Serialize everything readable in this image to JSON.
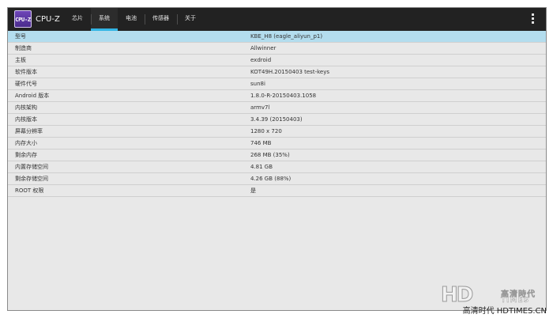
{
  "app": {
    "title": "CPU-Z",
    "icon_label": "CPU-Z",
    "icon": "cpu-z-app-icon"
  },
  "tabs": [
    {
      "label": "芯片",
      "active": false
    },
    {
      "label": "系统",
      "active": true
    },
    {
      "label": "电池",
      "active": false
    },
    {
      "label": "传感器",
      "active": false
    },
    {
      "label": "关于",
      "active": false
    }
  ],
  "menu_icon": "overflow-menu-icon",
  "colors": {
    "actionbar": "#222222",
    "tab_indicator": "#33b5e5",
    "selected_row": "#b3ddee",
    "background": "#e8e8e8"
  },
  "system_info": [
    {
      "label": "型号",
      "value": "KBE_H8 (eagle_aliyun_p1)"
    },
    {
      "label": "制造商",
      "value": "Allwinner"
    },
    {
      "label": "主板",
      "value": "exdroid"
    },
    {
      "label": "软件版本",
      "value": "KOT49H.20150403 test-keys"
    },
    {
      "label": "硬件代号",
      "value": "sun8i"
    },
    {
      "label": "Android 版本",
      "value": "1.8.0-R-20150403.1058"
    },
    {
      "label": "内核架构",
      "value": "armv7l"
    },
    {
      "label": "内核版本",
      "value": "3.4.39 (20150403)"
    },
    {
      "label": "屏幕分辨率",
      "value": "1280 x 720"
    },
    {
      "label": "内存大小",
      "value": "746 MB"
    },
    {
      "label": "剩余内存",
      "value": "268 MB  (35%)"
    },
    {
      "label": "内置存储空间",
      "value": "4.81 GB"
    },
    {
      "label": "剩余存储空间",
      "value": "4.26 GB (88%)"
    },
    {
      "label": "ROOT 权限",
      "value": "是"
    }
  ],
  "watermark": {
    "logo_text": "HD",
    "logo_cn": "高清時代",
    "logo_en": "TIMES",
    "caption": "高清时代 HDTIMES.CN"
  }
}
